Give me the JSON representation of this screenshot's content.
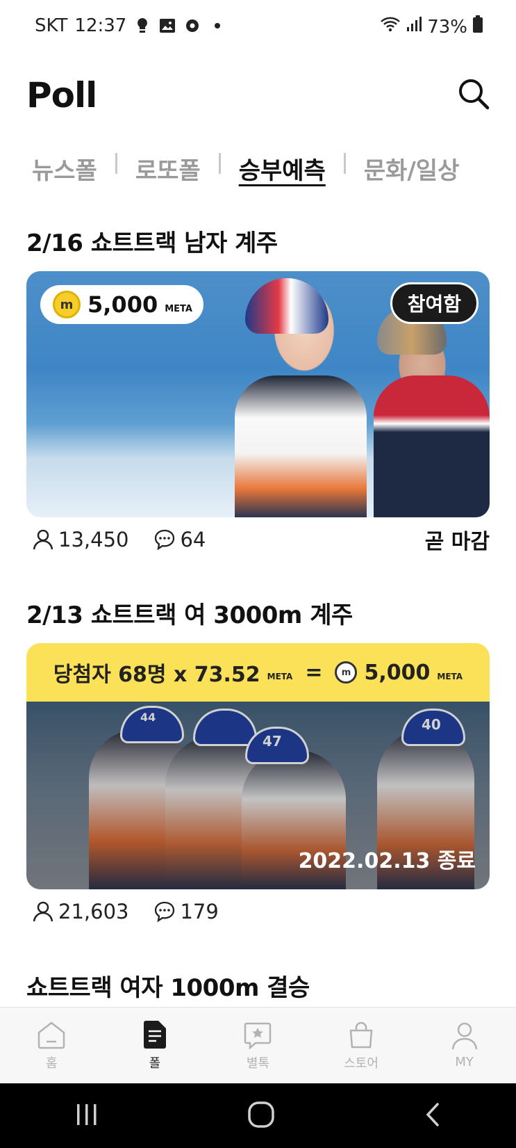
{
  "status_bar": {
    "carrier": "SKT",
    "time": "12:37",
    "battery": "73%",
    "icons": [
      "lightbulb-icon",
      "image-icon",
      "settings-icon",
      "dot-icon",
      "wifi-icon",
      "signal-icon",
      "battery-icon"
    ]
  },
  "header": {
    "title": "Poll",
    "search_icon": "search-icon"
  },
  "tabs": [
    {
      "label": "뉴스폴",
      "active": false
    },
    {
      "label": "로또폴",
      "active": false
    },
    {
      "label": "승부예측",
      "active": true
    },
    {
      "label": "문화/일상",
      "active": false
    }
  ],
  "polls": [
    {
      "title": "2/16  쇼트트랙 남자 계주",
      "reward_amount": "5,000",
      "reward_unit": "META",
      "coin_glyph": "m",
      "badge": "참여함",
      "participants": "13,450",
      "comments": "64",
      "status": "곧 마감"
    },
    {
      "title": "2/13 쇼트트랙 여 3000m 계주",
      "winner_text": "당첨자 68명 x 73.52",
      "winner_unit": "META",
      "equals": "=",
      "reward_amount": "5,000",
      "reward_unit": "META",
      "helmet_numbers": [
        "44",
        "47",
        "40"
      ],
      "ended_text": "2022.02.13 종료",
      "participants": "21,603",
      "comments": "179"
    }
  ],
  "next_section_title": "쇼트트랙 여자 1000m 결승",
  "bottom_nav": [
    {
      "label": "홈",
      "icon": "home-icon",
      "active": false
    },
    {
      "label": "폴",
      "icon": "poll-document-icon",
      "active": true
    },
    {
      "label": "별톡",
      "icon": "star-chat-icon",
      "active": false
    },
    {
      "label": "스토어",
      "icon": "shopping-bag-icon",
      "active": false
    },
    {
      "label": "MY",
      "icon": "person-icon",
      "active": false
    }
  ],
  "colors": {
    "accent_yellow": "#fbe157",
    "coin_yellow": "#f7cd2a",
    "tab_inactive": "#9a9a9a",
    "nav_inactive": "#b2b2b2"
  }
}
